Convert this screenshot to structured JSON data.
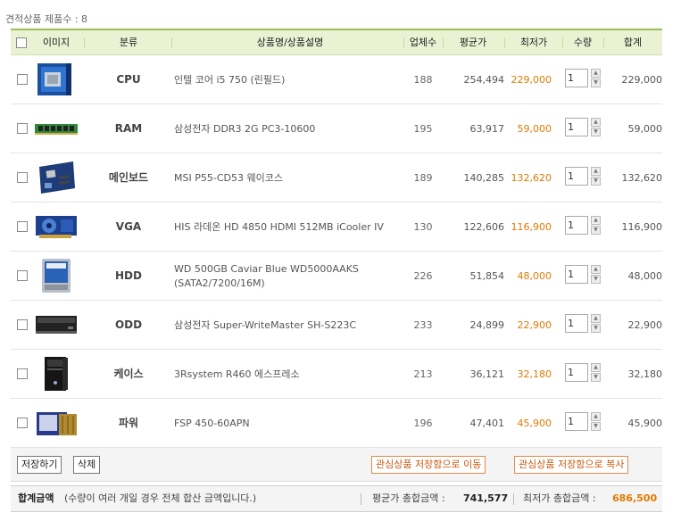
{
  "count_label": "견적상품 제품수 : 8",
  "header": {
    "image": "이미지",
    "category": "분류",
    "product": "상품명/상품설명",
    "vendors": "업체수",
    "avg": "평균가",
    "lowest": "최저가",
    "qty": "수량",
    "total": "합계"
  },
  "rows": [
    {
      "category": "CPU",
      "name": "인텔 코어 i5 750 (린필드)",
      "vendors": "188",
      "avg": "254,494",
      "lowest": "229,000",
      "qty": "1",
      "total": "229,000",
      "icon": "cpu-box-icon"
    },
    {
      "category": "RAM",
      "name": "삼성전자 DDR3 2G PC3-10600",
      "vendors": "195",
      "avg": "63,917",
      "lowest": "59,000",
      "qty": "1",
      "total": "59,000",
      "icon": "ram-module-icon"
    },
    {
      "category": "메인보드",
      "name": "MSI P55-CD53 웨이코스",
      "vendors": "189",
      "avg": "140,285",
      "lowest": "132,620",
      "qty": "1",
      "total": "132,620",
      "icon": "motherboard-icon"
    },
    {
      "category": "VGA",
      "name": "HIS 라데온 HD 4850 HDMI 512MB iCooler IV",
      "vendors": "130",
      "avg": "122,606",
      "lowest": "116,900",
      "qty": "1",
      "total": "116,900",
      "icon": "graphics-card-icon"
    },
    {
      "category": "HDD",
      "name": "WD 500GB Caviar Blue WD5000AAKS (SATA2/7200/16M)",
      "vendors": "226",
      "avg": "51,854",
      "lowest": "48,000",
      "qty": "1",
      "total": "48,000",
      "icon": "hard-drive-icon"
    },
    {
      "category": "ODD",
      "name": "삼성전자 Super-WriteMaster SH-S223C",
      "vendors": "233",
      "avg": "24,899",
      "lowest": "22,900",
      "qty": "1",
      "total": "22,900",
      "icon": "optical-drive-icon"
    },
    {
      "category": "케이스",
      "name": "3Rsystem R460 에스프레소",
      "vendors": "213",
      "avg": "36,121",
      "lowest": "32,180",
      "qty": "1",
      "total": "32,180",
      "icon": "pc-case-icon"
    },
    {
      "category": "파워",
      "name": "FSP 450-60APN",
      "vendors": "196",
      "avg": "47,401",
      "lowest": "45,900",
      "qty": "1",
      "total": "45,900",
      "icon": "power-supply-icon"
    }
  ],
  "actions": {
    "save": "저장하기",
    "delete": "삭제",
    "move_wishlist": "관심상품 저장함으로 이동",
    "copy_wishlist": "관심상품 저장함으로 복사"
  },
  "summary": {
    "title": "합계금액",
    "note": "(수량이 여러 개일 경우 전체 합산 금액입니다.)",
    "avg_label": "평균가 총합금액 : ",
    "avg_value": "741,577",
    "low_label": "최저가 총합금액 : ",
    "low_value": "686,500"
  },
  "colors": {
    "accent_orange": "#e07a00",
    "header_green": "#e9f3d4"
  }
}
